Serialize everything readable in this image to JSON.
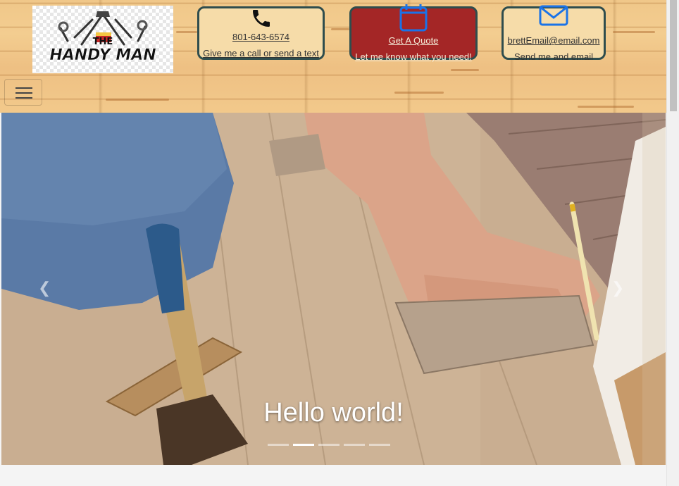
{
  "logo": {
    "line_top": "THE",
    "line_main": "HANDY MAN"
  },
  "contact": {
    "phone": {
      "icon": "phone-icon",
      "line1": "801-643-6574",
      "line2": "Give me a call or send a text"
    },
    "quote": {
      "icon": "calendar-icon",
      "line1": "Get A Quote",
      "line2": "Let me know what you need!"
    },
    "email": {
      "icon": "envelope-icon",
      "line1": "brettEmail@email.com",
      "line2": "Send me and email"
    }
  },
  "nav": {
    "toggler_icon": "hamburger-menu-icon"
  },
  "carousel": {
    "caption": "Hello world!",
    "slide_count": 5,
    "active_index": 1,
    "prev_icon": "chevron-left-icon",
    "next_icon": "chevron-right-icon"
  },
  "colors": {
    "card_border": "#2f4d4d",
    "card_bg": "#f6dca9",
    "quote_bg": "#a42626",
    "icon_blue": "#1a73e8"
  }
}
